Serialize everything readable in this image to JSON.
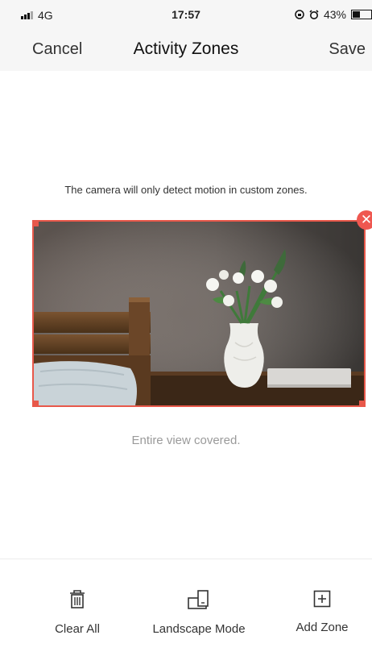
{
  "status_bar": {
    "network": "4G",
    "time": "17:57",
    "battery_percent": "43%",
    "battery_level": 0.43
  },
  "nav": {
    "cancel_label": "Cancel",
    "title": "Activity Zones",
    "save_label": "Save"
  },
  "hint_text": "The camera will only detect motion in custom zones.",
  "coverage_text": "Entire view covered.",
  "toolbar": {
    "clear_all_label": "Clear All",
    "landscape_mode_label": "Landscape Mode",
    "add_zone_label": "Add Zone"
  },
  "colors": {
    "zone_border": "#e8584a",
    "close_badge": "#ef5750"
  },
  "icons": {
    "clear_all": "trash-icon",
    "landscape_mode": "rotate-screen-icon",
    "add_zone": "add-square-icon",
    "close": "close-icon"
  }
}
